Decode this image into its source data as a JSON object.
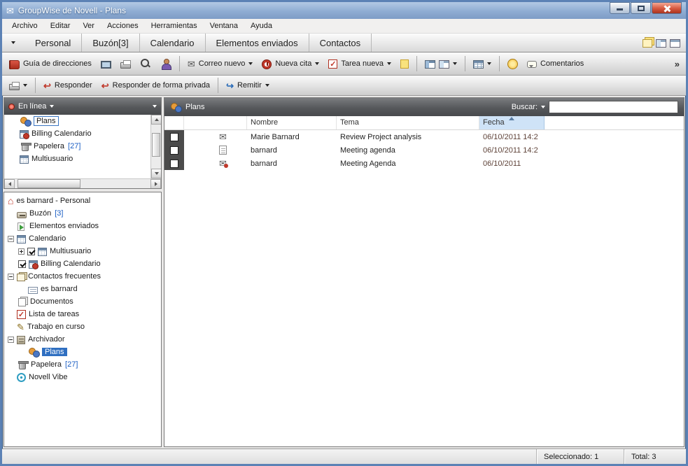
{
  "window": {
    "title": "GroupWise de Novell - Plans"
  },
  "icons": {
    "envelope": "✉",
    "reply": "↩",
    "forward": "↪",
    "overflow": "»",
    "home": "⌂",
    "pencil": "✎",
    "check": "✓"
  },
  "menubar": {
    "items": [
      "Archivo",
      "Editar",
      "Ver",
      "Acciones",
      "Herramientas",
      "Ventana",
      "Ayuda"
    ]
  },
  "tabbar": {
    "tabs": [
      "Personal",
      "Buzón[3]",
      "Calendario",
      "Elementos enviados",
      "Contactos"
    ]
  },
  "toolbar_main": {
    "address_book": "Guía de direcciones",
    "new_mail": "Correo nuevo",
    "new_appointment": "Nueva cita",
    "new_task": "Tarea nueva",
    "comments": "Comentarios"
  },
  "toolbar_actions": {
    "reply": "Responder",
    "reply_private": "Responder de forma privada",
    "forward": "Remitir"
  },
  "folder_top": {
    "header": "En línea",
    "items": [
      {
        "label": "Plans"
      },
      {
        "label": "Billing Calendario"
      },
      {
        "label": "Papelera",
        "count": "[27]"
      },
      {
        "label": "Multiusuario"
      }
    ]
  },
  "folder_tree": {
    "root": "es barnard - Personal",
    "items": [
      {
        "label": "Buzón",
        "count": "[3]"
      },
      {
        "label": "Elementos enviados"
      },
      {
        "label": "Calendario"
      },
      {
        "label": "Multiusuario"
      },
      {
        "label": "Billing Calendario"
      },
      {
        "label": "Contactos frecuentes"
      },
      {
        "label": "es barnard"
      },
      {
        "label": "Documentos"
      },
      {
        "label": "Lista de tareas"
      },
      {
        "label": "Trabajo en curso"
      },
      {
        "label": "Archivador"
      },
      {
        "label": "Plans"
      },
      {
        "label": "Papelera",
        "count": "[27]"
      },
      {
        "label": "Novell Vibe"
      }
    ]
  },
  "list": {
    "header": "Plans",
    "search_label": "Buscar:",
    "columns": {
      "name": "Nombre",
      "subject": "Tema",
      "date": "Fecha"
    },
    "rows": [
      {
        "name": "Marie Barnard",
        "subject": "Review Project analysis",
        "date": "06/10/2011 14:2"
      },
      {
        "name": "barnard",
        "subject": "Meeting agenda",
        "date": "06/10/2011 14:2"
      },
      {
        "name": "barnard",
        "subject": "Meeting Agenda",
        "date": "06/10/2011"
      }
    ]
  },
  "statusbar": {
    "selected": "Seleccionado: 1",
    "total": "Total: 3"
  }
}
